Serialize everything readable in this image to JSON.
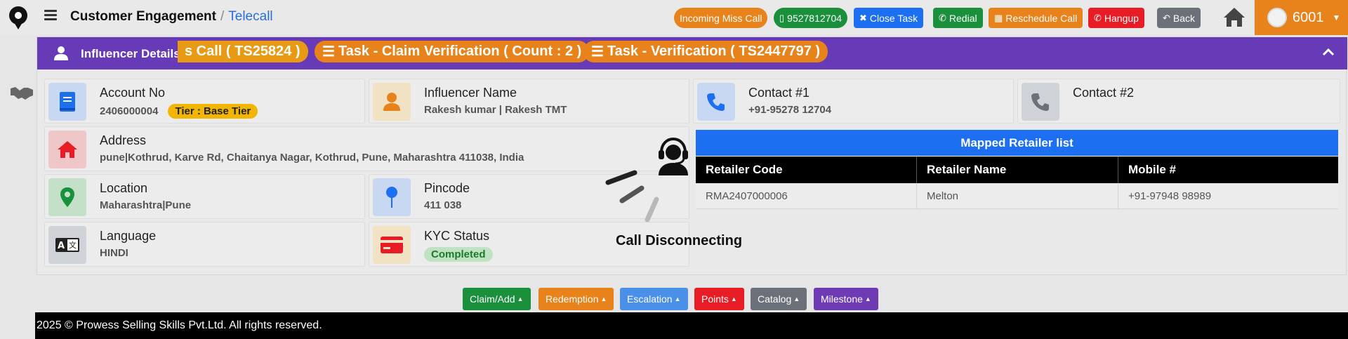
{
  "header": {
    "breadcrumb_main": "Customer Engagement",
    "breadcrumb_sep": "/",
    "breadcrumb_sub": "Telecall",
    "buttons": {
      "incoming_miss_call": "Incoming Miss Call",
      "phone_number": "9527812704",
      "close_task": "Close Task",
      "redial": "Redial",
      "reschedule_call": "Reschedule Call",
      "hangup": "Hangup",
      "back": "Back"
    },
    "user_id": "6001"
  },
  "panel": {
    "title": "Influencer Details",
    "badges": [
      "s Call ( TS25824 )",
      "Task - Claim Verification ( Count : 2 )",
      "Task - Verification ( TS2447797 )"
    ]
  },
  "cards": {
    "account": {
      "label": "Account No",
      "value": "2406000004",
      "tier": "Tier : Base Tier"
    },
    "influencer": {
      "label": "Influencer Name",
      "value": "Rakesh kumar | Rakesh TMT"
    },
    "contact1": {
      "label": "Contact #1",
      "value": "+91-95278 12704"
    },
    "contact2": {
      "label": "Contact #2",
      "value": ""
    },
    "address": {
      "label": "Address",
      "value": "pune|Kothrud, Karve Rd, Chaitanya Nagar, Kothrud, Pune, Maharashtra 411038, India"
    },
    "location": {
      "label": "Location",
      "value": "Maharashtra|Pune"
    },
    "pincode": {
      "label": "Pincode",
      "value": "411 038"
    },
    "language": {
      "label": "Language",
      "value": "HINDI"
    },
    "kyc": {
      "label": "KYC Status",
      "value": "Completed"
    }
  },
  "retailers": {
    "title": "Mapped Retailer list",
    "columns": [
      "Retailer Code",
      "Retailer Name",
      "Mobile #"
    ],
    "rows": [
      [
        "RMA2407000006",
        "Melton",
        "+91-97948 98989"
      ]
    ]
  },
  "call_status": "Call Disconnecting",
  "bottom_buttons": {
    "claim": "Claim/Add",
    "redemption": "Redemption",
    "escalation": "Escalation",
    "points": "Points",
    "catalog": "Catalog",
    "milestone": "Milestone"
  },
  "footer": "2025 © Prowess Selling Skills Pvt.Ltd. All rights reserved.",
  "colors": {
    "purple": "#673ab7",
    "orange": "#e8821a",
    "green": "#1a8f3c",
    "blue": "#1d6ff2",
    "red": "#e81c24",
    "gray": "#6c7079"
  }
}
